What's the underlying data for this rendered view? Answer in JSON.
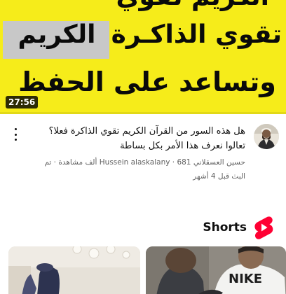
{
  "video": {
    "thumbnail": {
      "line_top": "الكريم تقوي",
      "line_mid_gray": "الكريم",
      "line_mid_yellow": "تقوي الذاكـرة",
      "line_bottom": "وتساعد على الحفظ",
      "background_color": "#f6ec1a"
    },
    "duration": "27:56",
    "title": "هل هذه السور من القرآن الكريم تقوي الذاكرة فعلا؟ تعالوا نعرف هذا الأمر بكل بساطة",
    "subtitle": "حسين العسقلاني Hussein alaskalany · 681 ألف مشاهدة · تم البث قبل 4 أشهر",
    "avatar_icon": "channel-avatar"
  },
  "shorts": {
    "label": "Shorts",
    "logo_icon": "shorts-logo-icon",
    "logo_color": "#ff0033"
  }
}
